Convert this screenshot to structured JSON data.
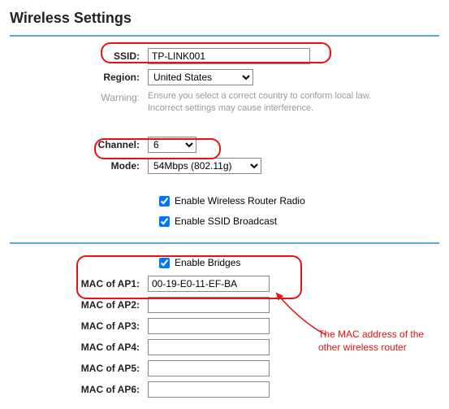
{
  "title": "Wireless Settings",
  "ssid": {
    "label": "SSID:",
    "value": "TP-LINK001"
  },
  "region": {
    "label": "Region:",
    "value": "United States"
  },
  "warning": {
    "label": "Warning:",
    "text1": "Ensure you select a correct country to conform local law.",
    "text2": "Incorrect settings may cause interference."
  },
  "channel": {
    "label": "Channel:",
    "value": "6"
  },
  "mode": {
    "label": "Mode:",
    "value": "54Mbps (802.11g)"
  },
  "checkboxes": {
    "radio": "Enable Wireless Router Radio",
    "ssid_bcast": "Enable SSID Broadcast",
    "bridges": "Enable Bridges"
  },
  "mac_aps": [
    {
      "label": "MAC of AP1:",
      "value": "00-19-E0-11-EF-BA"
    },
    {
      "label": "MAC of AP2:",
      "value": ""
    },
    {
      "label": "MAC of AP3:",
      "value": ""
    },
    {
      "label": "MAC of AP4:",
      "value": ""
    },
    {
      "label": "MAC of AP5:",
      "value": ""
    },
    {
      "label": "MAC of AP6:",
      "value": ""
    }
  ],
  "annotation": "The MAC address of the other wireless router",
  "highlight_color": "#e81010"
}
